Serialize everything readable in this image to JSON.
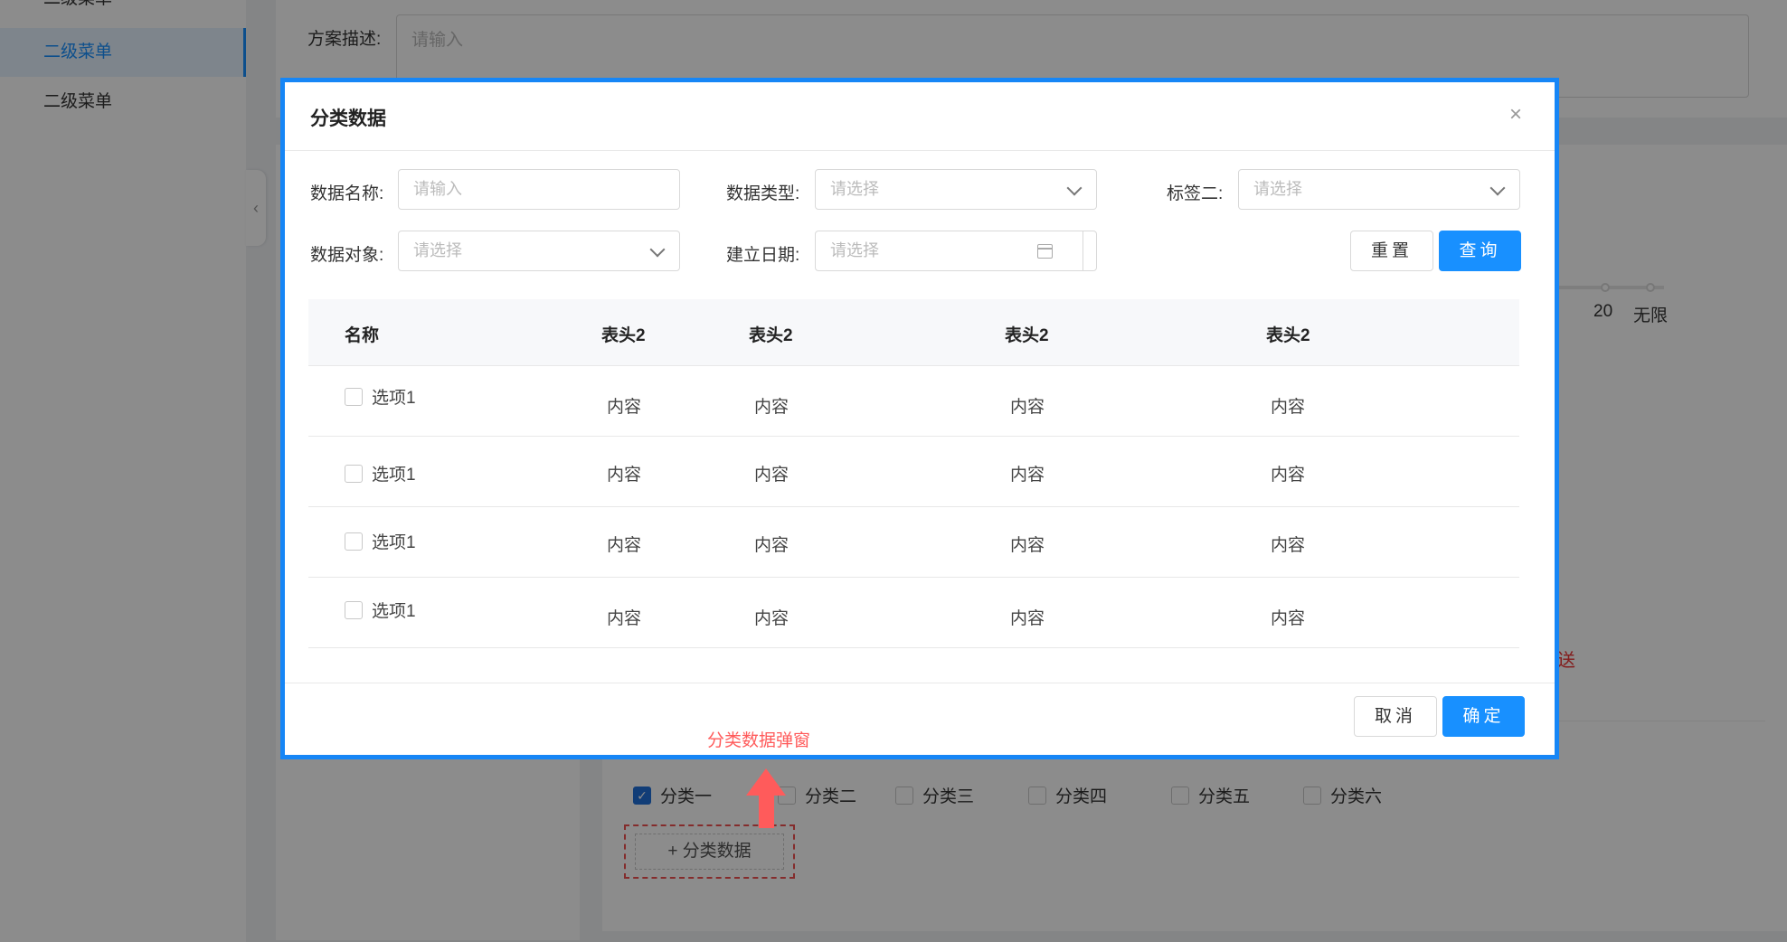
{
  "sidebar": {
    "items": [
      {
        "label": "二级菜单"
      },
      {
        "label": "二级菜单"
      },
      {
        "label": "二级菜单"
      }
    ],
    "collapse_glyph": "‹"
  },
  "background": {
    "desc_label": "方案描述:",
    "desc_placeholder": "请输入",
    "slider_ticks": [
      "20",
      "无限"
    ],
    "red_fragment": "送",
    "categories": [
      {
        "label": "分类一",
        "checked": true
      },
      {
        "label": "分类二",
        "checked": false
      },
      {
        "label": "分类三",
        "checked": false
      },
      {
        "label": "分类四",
        "checked": false
      },
      {
        "label": "分类五",
        "checked": false
      },
      {
        "label": "分类六",
        "checked": false
      }
    ],
    "add_category_label": "+ 分类数据"
  },
  "annotation": {
    "label": "分类数据弹窗",
    "color": "#ff5b5b"
  },
  "modal": {
    "title": "分类数据",
    "close_glyph": "×",
    "filters": {
      "data_name_label": "数据名称:",
      "data_name_placeholder": "请输入",
      "data_type_label": "数据类型:",
      "data_type_placeholder": "请选择",
      "tag2_label": "标签二:",
      "tag2_placeholder": "请选择",
      "data_object_label": "数据对象:",
      "data_object_placeholder": "请选择",
      "date_label": "建立日期:",
      "date_placeholder": "请选择"
    },
    "buttons": {
      "reset": "重置",
      "query": "查询",
      "cancel": "取消",
      "confirm": "确定"
    },
    "table": {
      "headers": [
        "名称",
        "表头2",
        "表头2",
        "表头2",
        "表头2"
      ],
      "rows": [
        {
          "name": "选项1",
          "cells": [
            "内容",
            "内容",
            "内容",
            "内容"
          ]
        },
        {
          "name": "选项1",
          "cells": [
            "内容",
            "内容",
            "内容",
            "内容"
          ]
        },
        {
          "name": "选项1",
          "cells": [
            "内容",
            "内容",
            "内容",
            "内容"
          ]
        },
        {
          "name": "选项1",
          "cells": [
            "内容",
            "内容",
            "内容",
            "内容"
          ]
        }
      ]
    }
  },
  "colors": {
    "primary": "#1890ff",
    "modal_border": "#1686f6",
    "checkbox_checked": "#1f6fd9",
    "danger": "#f05050"
  }
}
